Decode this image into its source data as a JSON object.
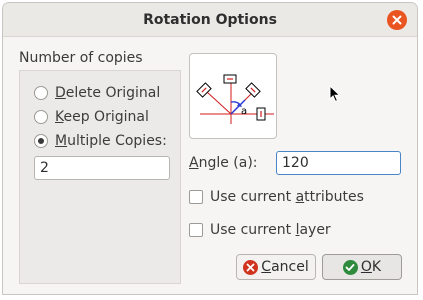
{
  "window": {
    "title": "Rotation Options",
    "close_icon": "close-icon"
  },
  "copies": {
    "group_label": "Number of copies",
    "options": [
      {
        "label_first": "D",
        "label_rest": "elete Original",
        "checked": false
      },
      {
        "label_first": "K",
        "label_rest": "eep Original",
        "checked": false
      },
      {
        "label_first": "M",
        "label_rest": "ultiple Copies:",
        "checked": true
      }
    ],
    "count_value": "2"
  },
  "angle": {
    "label": "Angle (a):",
    "value": "120",
    "illustration_label": "a"
  },
  "options": {
    "attributes_pre": "Use current ",
    "attributes_ul": "a",
    "attributes_post": "ttributes",
    "attributes_checked": false,
    "layer_pre": "Use current ",
    "layer_ul": "l",
    "layer_post": "ayer",
    "layer_checked": false
  },
  "buttons": {
    "cancel_first": "C",
    "cancel_rest": "ancel",
    "ok_first": "O",
    "ok_rest": "K"
  },
  "colors": {
    "accent_close": "#e95420",
    "cancel_icon": "#d0341f",
    "ok_icon": "#2e8b3d",
    "focus_border": "#4a86c7",
    "diagram_red": "#d11a1a",
    "diagram_blue": "#2a3fd6"
  }
}
